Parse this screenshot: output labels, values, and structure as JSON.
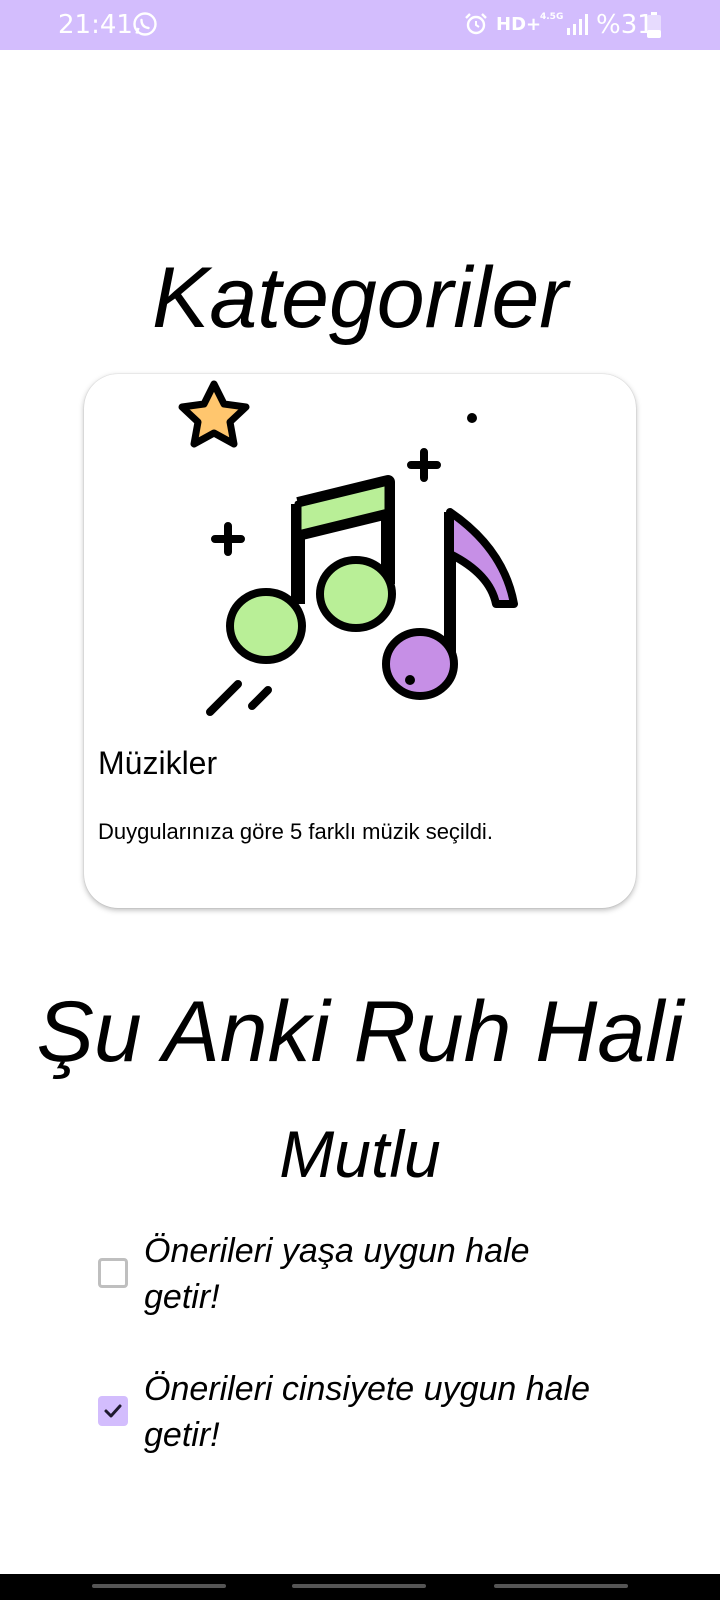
{
  "status_bar": {
    "time": "21:41",
    "network": "HD+",
    "network_sub": "4.5G",
    "battery_text": "%31",
    "color": "#d3bdfd",
    "icons": [
      "whatsapp-icon",
      "alarm-icon",
      "signal-icon",
      "battery-icon"
    ]
  },
  "page": {
    "title": "Kategoriler"
  },
  "card": {
    "title": "Müzikler",
    "description": "Duygularınıza göre 5 farklı müzik seçildi.",
    "illustration": "music-notes-icon"
  },
  "mood": {
    "heading": "Şu Anki Ruh Hali",
    "value": "Mutlu"
  },
  "options": [
    {
      "label": "Önerileri yaşa uygun hale getir!",
      "checked": false
    },
    {
      "label": "Önerileri cinsiyete uygun hale getir!",
      "checked": true
    }
  ],
  "colors": {
    "accent": "#d3bdfd",
    "note_green": "#b9ef97",
    "note_purple": "#c68fe6",
    "star": "#ffc66e"
  }
}
